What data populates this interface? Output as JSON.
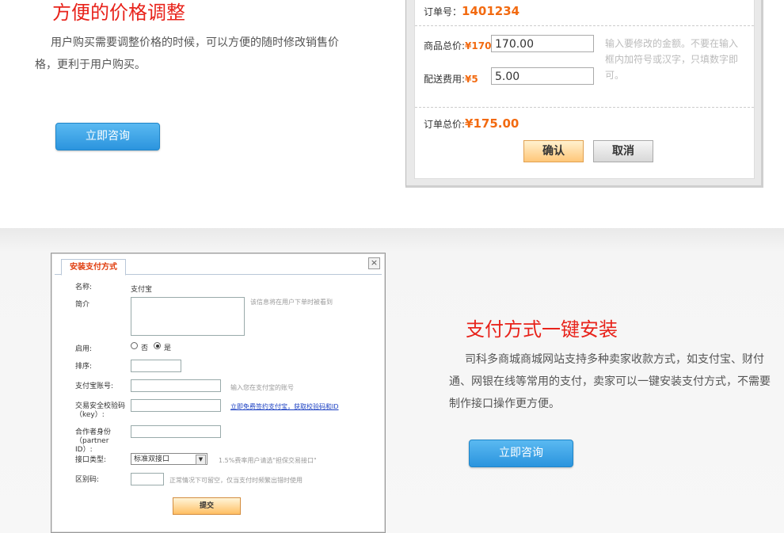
{
  "section1": {
    "title": "方便的价格调整",
    "description": "用户购买需要调整价格的时候，可以方便的随时修改销售价格，更利于用户购买。",
    "consult_button": "立即咨询",
    "panel": {
      "order_no_label": "订单号：",
      "order_no": "1401234",
      "goods_total_label": "商品总价:",
      "goods_total_amount": "¥170",
      "goods_total_input": "170.00",
      "shipping_label": "配送费用:",
      "shipping_amount": "¥5",
      "shipping_input": "5.00",
      "hint": "输入要修改的金额。不要在输入框内加符号或汉字，只填数字即可。",
      "order_total_label": "订单总价:",
      "order_total": "¥175.00",
      "confirm_button": "确认",
      "cancel_button": "取消"
    }
  },
  "section2": {
    "title": "支付方式一键安装",
    "description": "司科多商城商城网站支持多种卖家收款方式，如支付宝、财付通、网银在线等常用的支付，卖家可以一键安装支付方式，不需要制作接口操作更方便。",
    "consult_button": "立即咨询",
    "dialog": {
      "tab": "安装支付方式",
      "close_symbol": "×",
      "name_label": "名称:",
      "name_value": "支付宝",
      "intro_label": "简介",
      "intro_hint": "该信息将在用户下单时被看到",
      "enable_label": "启用:",
      "radio_no": "否",
      "radio_yes": "是",
      "sort_label": "排序:",
      "account_label": "支付宝账号:",
      "account_hint": "输入您在支付宝的账号",
      "key_label": "交易安全校验码（key）:",
      "key_link": "立即免费签约支付宝，获取校验码和ID",
      "partner_label": "合作者身份（partner ID）:",
      "interface_label": "接口类型:",
      "interface_value": "标准双接口",
      "interface_hint": "1.5%费率用户请选\"担保交易接口\"",
      "code_label": "区别码:",
      "code_hint": "正常情况下可留空，仅当支付时频繁出错时使用",
      "submit_button": "提交"
    }
  },
  "colors": {
    "title_red": "#e8231b",
    "price_orange": "#f26a10",
    "button_blue": "#2b94de"
  },
  "icons": {
    "close": "close-icon",
    "select_arrow": "chevron-down-icon"
  }
}
